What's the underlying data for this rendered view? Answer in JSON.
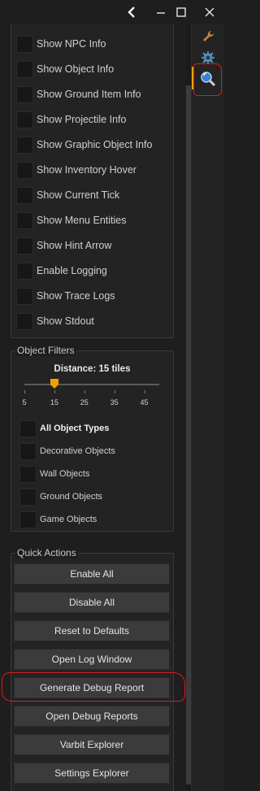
{
  "window": {
    "controls": {
      "back_icon": "chevron-left-icon",
      "minimize": "minimize-icon",
      "maximize": "maximize-icon",
      "close": "close-icon"
    }
  },
  "side_panel": {
    "icons": [
      "wrench-icon",
      "gear-plugin-icon",
      "magnifier-icon"
    ]
  },
  "debug_options": [
    {
      "label": "Show NPC Info",
      "checked": false
    },
    {
      "label": "Show Object Info",
      "checked": false
    },
    {
      "label": "Show Ground Item Info",
      "checked": false
    },
    {
      "label": "Show Projectile Info",
      "checked": false
    },
    {
      "label": "Show Graphic Object Info",
      "checked": false
    },
    {
      "label": "Show Inventory Hover",
      "checked": false
    },
    {
      "label": "Show Current Tick",
      "checked": false
    },
    {
      "label": "Show Menu Entities",
      "checked": false
    },
    {
      "label": "Show Hint Arrow",
      "checked": false
    },
    {
      "label": "Enable Logging",
      "checked": false
    },
    {
      "label": "Show Trace Logs",
      "checked": false
    },
    {
      "label": "Show Stdout",
      "checked": false
    }
  ],
  "object_filters": {
    "title": "Object Filters",
    "distance_label": "Distance: 15 tiles",
    "distance_value": 15,
    "slider_min": 5,
    "slider_max": 50,
    "ticks": [
      "5",
      "15",
      "25",
      "35",
      "45"
    ],
    "options": [
      {
        "label": "All Object Types",
        "checked": false
      },
      {
        "label": "Decorative Objects",
        "checked": false
      },
      {
        "label": "Wall Objects",
        "checked": false
      },
      {
        "label": "Ground Objects",
        "checked": false
      },
      {
        "label": "Game Objects",
        "checked": false
      }
    ]
  },
  "quick_actions": {
    "title": "Quick Actions",
    "buttons": [
      "Enable All",
      "Disable All",
      "Reset to Defaults",
      "Open Log Window",
      "Generate Debug Report",
      "Open Debug Reports",
      "Varbit Explorer",
      "Settings Explorer"
    ]
  },
  "colors": {
    "background": "#1e1e1e",
    "panel": "#232323",
    "button": "#3b3b3b",
    "accent_orange": "#f0a000",
    "annotation_red": "#e0191c"
  }
}
